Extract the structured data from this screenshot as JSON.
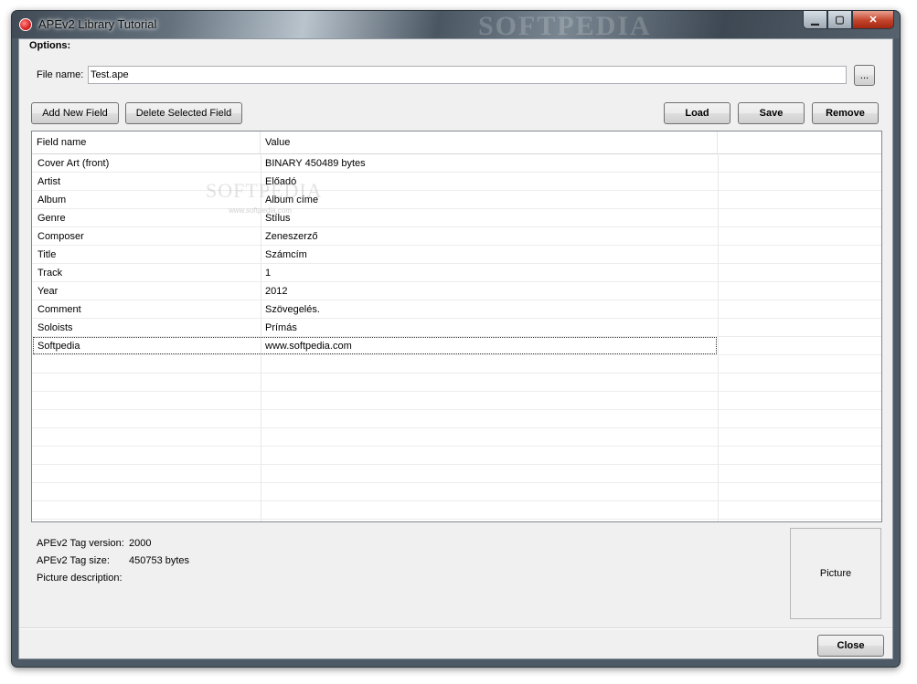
{
  "window": {
    "title": "APEv2 Library Tutorial",
    "watermark": "SOFTPEDIA",
    "controls": {
      "minimize": "▁",
      "maximize": "▢",
      "close": "✕"
    }
  },
  "options": {
    "label": "Options:",
    "file_name_label": "File name:",
    "file_name_value": "Test.ape",
    "browse_label": "..."
  },
  "toolbar": {
    "add_label": "Add New Field",
    "delete_label": "Delete Selected Field",
    "load_label": "Load",
    "save_label": "Save",
    "remove_label": "Remove"
  },
  "table": {
    "headers": [
      "Field name",
      "Value"
    ],
    "rows": [
      {
        "field": "Cover Art (front)",
        "value": "BINARY 450489 bytes"
      },
      {
        "field": "Artist",
        "value": "Előadó"
      },
      {
        "field": "Album",
        "value": "Album címe"
      },
      {
        "field": "Genre",
        "value": "Stílus"
      },
      {
        "field": "Composer",
        "value": "Zeneszerző"
      },
      {
        "field": "Title",
        "value": "Számcím"
      },
      {
        "field": "Track",
        "value": "1"
      },
      {
        "field": "Year",
        "value": "2012"
      },
      {
        "field": "Comment",
        "value": "Szövegelés."
      },
      {
        "field": "Soloists",
        "value": "Prímás"
      },
      {
        "field": "Softpedia",
        "value": "www.softpedia.com"
      }
    ],
    "selected_row": 10,
    "watermark": "SOFTPEDIA",
    "watermark_sub": "www.softpedia.com"
  },
  "info": {
    "tag_version_label": "APEv2 Tag version:",
    "tag_version_value": "2000",
    "tag_size_label": "APEv2 Tag size:",
    "tag_size_value": "450753 bytes",
    "picture_description_label": "Picture description:",
    "picture_label": "Picture"
  },
  "footer": {
    "close_label": "Close"
  }
}
